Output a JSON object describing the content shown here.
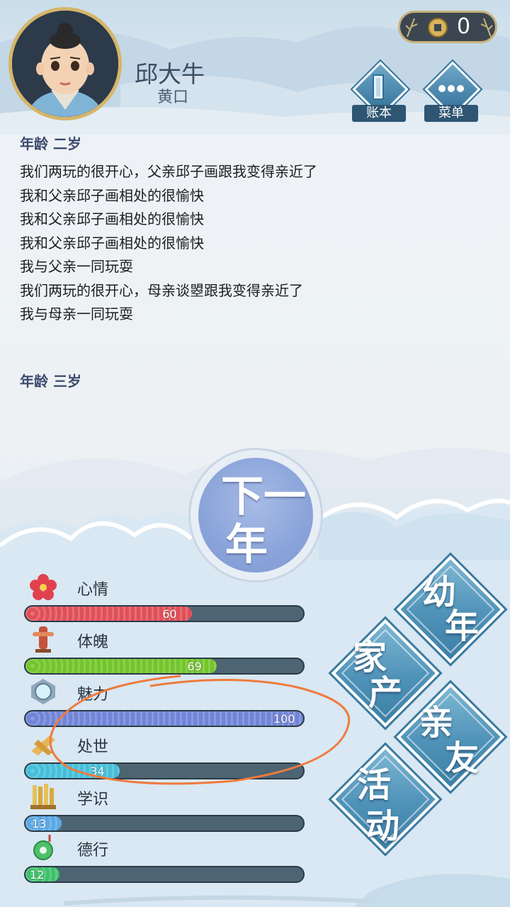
{
  "player": {
    "name": "邱大牛",
    "status": "黄口"
  },
  "currency": {
    "icon": "copper-coin-icon",
    "amount": "0"
  },
  "top_buttons": {
    "ledger_label": "账本",
    "menu_label": "菜单"
  },
  "log": {
    "sections": [
      {
        "heading": "年龄 二岁",
        "lines": [
          "我们两玩的很开心，父亲邱子画跟我变得亲近了",
          "我和父亲邱子画相处的很愉快",
          "我和父亲邱子画相处的很愉快",
          "我和父亲邱子画相处的很愉快",
          "我与父亲一同玩耍",
          "我们两玩的很开心，母亲谈曌跟我变得亲近了",
          "我与母亲一同玩耍"
        ]
      },
      {
        "heading": "年龄 三岁",
        "lines": []
      }
    ]
  },
  "next_year": {
    "line1": "下一",
    "line2": "年"
  },
  "stats": [
    {
      "label": "心情",
      "value": "60",
      "fraction": 0.6,
      "color": "#e04f58",
      "icon": "flower-icon"
    },
    {
      "label": "体魄",
      "value": "69",
      "fraction": 0.69,
      "color": "#72c52a",
      "icon": "training-dummy-icon"
    },
    {
      "label": "魅力",
      "value": "100",
      "fraction": 1.0,
      "color": "#7184d8",
      "icon": "mirror-icon"
    },
    {
      "label": "处世",
      "value": "34",
      "fraction": 0.34,
      "color": "#45bfd9",
      "icon": "scroll-icon"
    },
    {
      "label": "学识",
      "value": "13",
      "fraction": 0.13,
      "color": "#5aa8e6",
      "icon": "books-icon"
    },
    {
      "label": "德行",
      "value": "12",
      "fraction": 0.12,
      "color": "#3cc26a",
      "icon": "jade-pendant-icon"
    }
  ],
  "tiles": {
    "childhood": [
      "幼",
      "年"
    ],
    "family_property": [
      "家",
      "产"
    ],
    "relatives": [
      "亲",
      "友"
    ],
    "activities": [
      "活",
      "动"
    ]
  },
  "colors": {
    "accent": "#3a7aa0",
    "annotation": "#f07a3c",
    "age_heading": "#3b4a6b"
  }
}
